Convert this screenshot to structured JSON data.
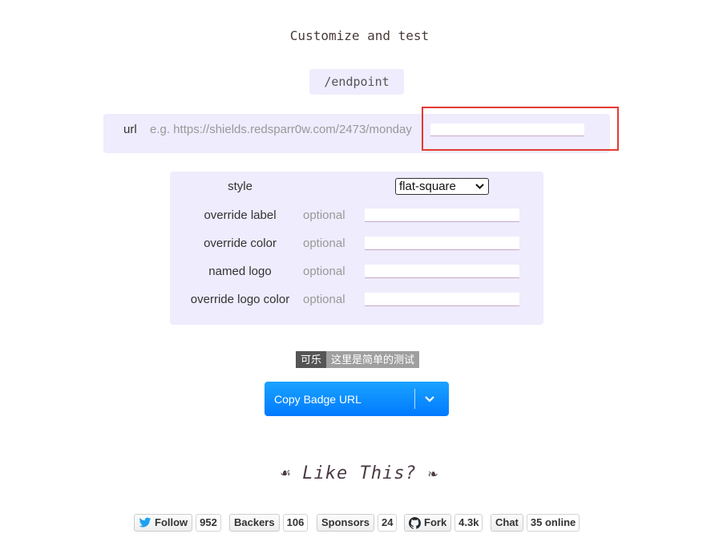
{
  "heading": "Customize and test",
  "endpoint": "/endpoint",
  "url": {
    "label": "url",
    "example": "e.g. https://shields.redsparr0w.com/2473/monday",
    "value": ""
  },
  "options": {
    "style_label": "style",
    "style_value": "flat-square",
    "fields": [
      {
        "label": "override label",
        "placeholder": "optional"
      },
      {
        "label": "override color",
        "placeholder": "optional"
      },
      {
        "label": "named logo",
        "placeholder": "optional"
      },
      {
        "label": "override logo color",
        "placeholder": "optional"
      }
    ]
  },
  "badge": {
    "left": "可乐",
    "right": "这里是简单的测试",
    "left_color": "#555555",
    "right_color": "#9f9f9f"
  },
  "copy_button": {
    "label": "Copy Badge URL",
    "icon": "chevron-down-icon",
    "color": "#1c8bff"
  },
  "like_this": "Like This?",
  "social": {
    "follow": {
      "label": "Follow",
      "count": "952",
      "icon": "twitter-icon"
    },
    "backers": {
      "label": "Backers",
      "count": "106"
    },
    "sponsors": {
      "label": "Sponsors",
      "count": "24"
    },
    "fork": {
      "label": "Fork",
      "count": "4.3k",
      "icon": "github-icon"
    },
    "chat": {
      "label": "Chat",
      "count": "35 online"
    }
  }
}
